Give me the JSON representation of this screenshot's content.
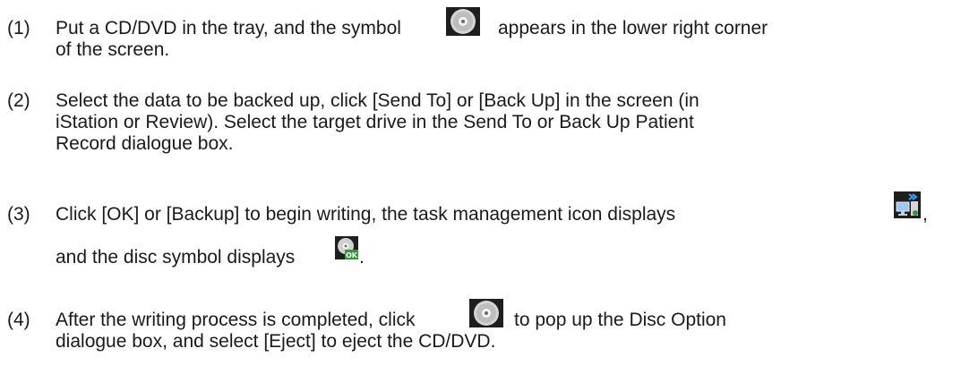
{
  "steps": [
    {
      "number": "(1)",
      "line1_before": "Put a CD/DVD in the tray, and the symbol",
      "line1_after": "appears in the lower right corner",
      "line2": "of the screen."
    },
    {
      "number": "(2)",
      "line1": "Select the data to be backed up, click [Send To] or [Back Up] in the screen (in",
      "line2": "iStation or Review). Select the target drive in the Send To or Back Up Patient",
      "line3": "Record dialogue box."
    },
    {
      "number": "(3)",
      "line1_before": "Click [OK] or [Backup] to begin writing, the task management icon displays",
      "line1_after": ",",
      "line2_before": "and the disc symbol displays",
      "line2_after": "."
    },
    {
      "number": "(4)",
      "line1_before": "After the writing process is completed, click",
      "line1_after": "to pop up the Disc Option",
      "line2": "dialogue box, and select [Eject] to eject the CD/DVD."
    }
  ],
  "icons": {
    "disc": "disc-icon",
    "disc_ok": "disc-ok-icon",
    "task_management": "task-management-icon",
    "ok_badge_text": "OK"
  },
  "colors": {
    "text": "#1a1a1a",
    "icon_bg": "#1e1e1e",
    "disc_silver": "#c8c8c8",
    "ok_green": "#2e9a3a",
    "arrow_blue": "#3aa0ff"
  }
}
